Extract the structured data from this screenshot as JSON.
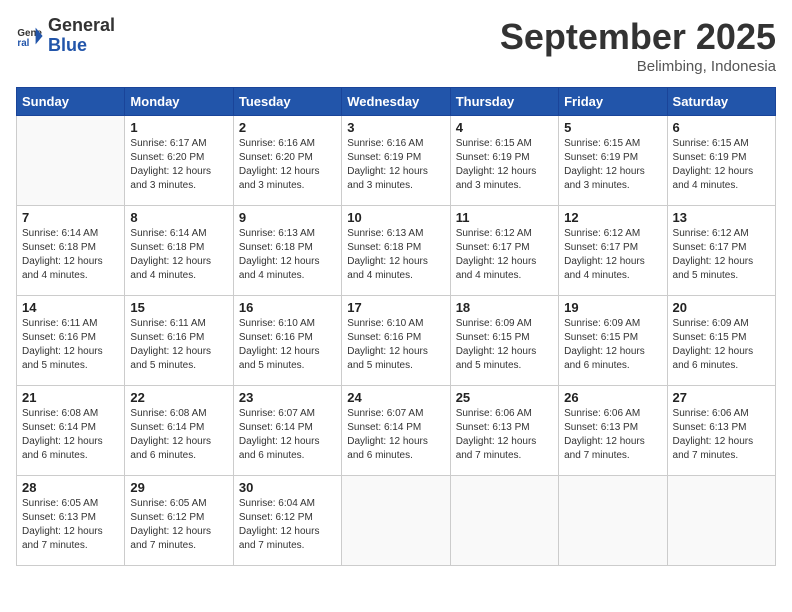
{
  "logo": {
    "general": "General",
    "blue": "Blue"
  },
  "title": "September 2025",
  "subtitle": "Belimbing, Indonesia",
  "days_of_week": [
    "Sunday",
    "Monday",
    "Tuesday",
    "Wednesday",
    "Thursday",
    "Friday",
    "Saturday"
  ],
  "weeks": [
    [
      {
        "day": "",
        "info": ""
      },
      {
        "day": "1",
        "info": "Sunrise: 6:17 AM\nSunset: 6:20 PM\nDaylight: 12 hours\nand 3 minutes."
      },
      {
        "day": "2",
        "info": "Sunrise: 6:16 AM\nSunset: 6:20 PM\nDaylight: 12 hours\nand 3 minutes."
      },
      {
        "day": "3",
        "info": "Sunrise: 6:16 AM\nSunset: 6:19 PM\nDaylight: 12 hours\nand 3 minutes."
      },
      {
        "day": "4",
        "info": "Sunrise: 6:15 AM\nSunset: 6:19 PM\nDaylight: 12 hours\nand 3 minutes."
      },
      {
        "day": "5",
        "info": "Sunrise: 6:15 AM\nSunset: 6:19 PM\nDaylight: 12 hours\nand 3 minutes."
      },
      {
        "day": "6",
        "info": "Sunrise: 6:15 AM\nSunset: 6:19 PM\nDaylight: 12 hours\nand 4 minutes."
      }
    ],
    [
      {
        "day": "7",
        "info": "Sunrise: 6:14 AM\nSunset: 6:18 PM\nDaylight: 12 hours\nand 4 minutes."
      },
      {
        "day": "8",
        "info": "Sunrise: 6:14 AM\nSunset: 6:18 PM\nDaylight: 12 hours\nand 4 minutes."
      },
      {
        "day": "9",
        "info": "Sunrise: 6:13 AM\nSunset: 6:18 PM\nDaylight: 12 hours\nand 4 minutes."
      },
      {
        "day": "10",
        "info": "Sunrise: 6:13 AM\nSunset: 6:18 PM\nDaylight: 12 hours\nand 4 minutes."
      },
      {
        "day": "11",
        "info": "Sunrise: 6:12 AM\nSunset: 6:17 PM\nDaylight: 12 hours\nand 4 minutes."
      },
      {
        "day": "12",
        "info": "Sunrise: 6:12 AM\nSunset: 6:17 PM\nDaylight: 12 hours\nand 4 minutes."
      },
      {
        "day": "13",
        "info": "Sunrise: 6:12 AM\nSunset: 6:17 PM\nDaylight: 12 hours\nand 5 minutes."
      }
    ],
    [
      {
        "day": "14",
        "info": "Sunrise: 6:11 AM\nSunset: 6:16 PM\nDaylight: 12 hours\nand 5 minutes."
      },
      {
        "day": "15",
        "info": "Sunrise: 6:11 AM\nSunset: 6:16 PM\nDaylight: 12 hours\nand 5 minutes."
      },
      {
        "day": "16",
        "info": "Sunrise: 6:10 AM\nSunset: 6:16 PM\nDaylight: 12 hours\nand 5 minutes."
      },
      {
        "day": "17",
        "info": "Sunrise: 6:10 AM\nSunset: 6:16 PM\nDaylight: 12 hours\nand 5 minutes."
      },
      {
        "day": "18",
        "info": "Sunrise: 6:09 AM\nSunset: 6:15 PM\nDaylight: 12 hours\nand 5 minutes."
      },
      {
        "day": "19",
        "info": "Sunrise: 6:09 AM\nSunset: 6:15 PM\nDaylight: 12 hours\nand 6 minutes."
      },
      {
        "day": "20",
        "info": "Sunrise: 6:09 AM\nSunset: 6:15 PM\nDaylight: 12 hours\nand 6 minutes."
      }
    ],
    [
      {
        "day": "21",
        "info": "Sunrise: 6:08 AM\nSunset: 6:14 PM\nDaylight: 12 hours\nand 6 minutes."
      },
      {
        "day": "22",
        "info": "Sunrise: 6:08 AM\nSunset: 6:14 PM\nDaylight: 12 hours\nand 6 minutes."
      },
      {
        "day": "23",
        "info": "Sunrise: 6:07 AM\nSunset: 6:14 PM\nDaylight: 12 hours\nand 6 minutes."
      },
      {
        "day": "24",
        "info": "Sunrise: 6:07 AM\nSunset: 6:14 PM\nDaylight: 12 hours\nand 6 minutes."
      },
      {
        "day": "25",
        "info": "Sunrise: 6:06 AM\nSunset: 6:13 PM\nDaylight: 12 hours\nand 7 minutes."
      },
      {
        "day": "26",
        "info": "Sunrise: 6:06 AM\nSunset: 6:13 PM\nDaylight: 12 hours\nand 7 minutes."
      },
      {
        "day": "27",
        "info": "Sunrise: 6:06 AM\nSunset: 6:13 PM\nDaylight: 12 hours\nand 7 minutes."
      }
    ],
    [
      {
        "day": "28",
        "info": "Sunrise: 6:05 AM\nSunset: 6:13 PM\nDaylight: 12 hours\nand 7 minutes."
      },
      {
        "day": "29",
        "info": "Sunrise: 6:05 AM\nSunset: 6:12 PM\nDaylight: 12 hours\nand 7 minutes."
      },
      {
        "day": "30",
        "info": "Sunrise: 6:04 AM\nSunset: 6:12 PM\nDaylight: 12 hours\nand 7 minutes."
      },
      {
        "day": "",
        "info": ""
      },
      {
        "day": "",
        "info": ""
      },
      {
        "day": "",
        "info": ""
      },
      {
        "day": "",
        "info": ""
      }
    ]
  ]
}
